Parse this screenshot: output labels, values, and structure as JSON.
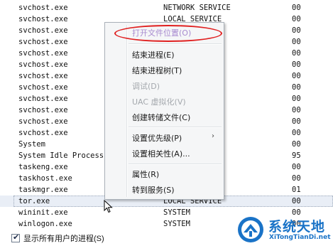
{
  "processes": [
    {
      "name": "svchost.exe",
      "user": "NETWORK SERVICE",
      "cpu": "00"
    },
    {
      "name": "svchost.exe",
      "user": "LOCAL SERVICE",
      "cpu": "00"
    },
    {
      "name": "svchost.exe",
      "user": "",
      "cpu": "00"
    },
    {
      "name": "svchost.exe",
      "user": "",
      "cpu": "00"
    },
    {
      "name": "svchost.exe",
      "user": "",
      "cpu": "00"
    },
    {
      "name": "svchost.exe",
      "user": "",
      "cpu": "00"
    },
    {
      "name": "svchost.exe",
      "user": "",
      "cpu": "00"
    },
    {
      "name": "svchost.exe",
      "user": "E",
      "cpu": "00"
    },
    {
      "name": "svchost.exe",
      "user": "",
      "cpu": "00"
    },
    {
      "name": "svchost.exe",
      "user": "",
      "cpu": "00"
    },
    {
      "name": "svchost.exe",
      "user": "",
      "cpu": "00"
    },
    {
      "name": "svchost.exe",
      "user": "",
      "cpu": "00"
    },
    {
      "name": "System",
      "user": "",
      "cpu": "00"
    },
    {
      "name": "System Idle Process",
      "user": "",
      "cpu": "95"
    },
    {
      "name": "taskeng.exe",
      "user": "",
      "cpu": "00"
    },
    {
      "name": "taskhost.exe",
      "user": "",
      "cpu": "00"
    },
    {
      "name": "taskmgr.exe",
      "user": "",
      "cpu": "01"
    },
    {
      "name": "tor.exe",
      "user": "LOCAL SERVICE",
      "cpu": "00"
    },
    {
      "name": "wininit.exe",
      "user": "SYSTEM",
      "cpu": "00"
    },
    {
      "name": "winlogon.exe",
      "user": "SYSTEM",
      "cpu": "00"
    }
  ],
  "selected_row": "tor.exe",
  "context_menu": {
    "items": [
      {
        "id": "open-file-location",
        "label": "打开文件位置(O)",
        "state": "highlighted",
        "circled": true
      },
      {
        "id": "end-process",
        "label": "结束进程(E)",
        "state": "normal"
      },
      {
        "id": "end-process-tree",
        "label": "结束进程树(T)",
        "state": "normal"
      },
      {
        "id": "debug",
        "label": "调试(D)",
        "state": "disabled"
      },
      {
        "id": "uac-virtualization",
        "label": "UAC 虚拟化(V)",
        "state": "disabled"
      },
      {
        "id": "create-dump",
        "label": "创建转储文件(C)",
        "state": "normal"
      },
      {
        "id": "set-priority",
        "label": "设置优先级(P)",
        "state": "normal",
        "submenu": true
      },
      {
        "id": "set-affinity",
        "label": "设置相关性(A)...",
        "state": "normal"
      },
      {
        "id": "properties",
        "label": "属性(R)",
        "state": "normal"
      },
      {
        "id": "go-to-service",
        "label": "转到服务(S)",
        "state": "normal"
      }
    ],
    "submenu_arrow": "›"
  },
  "footer": {
    "show_all_users_label": "显示所有用户的进程(S)",
    "checked": true,
    "check_glyph": "✔"
  },
  "watermark": {
    "title": "系统天地",
    "subtitle": "XiTongTianDi.net",
    "color": "#1a73c7"
  },
  "colors": {
    "highlight_circle": "#e02020",
    "selection": "#e9eef6"
  }
}
